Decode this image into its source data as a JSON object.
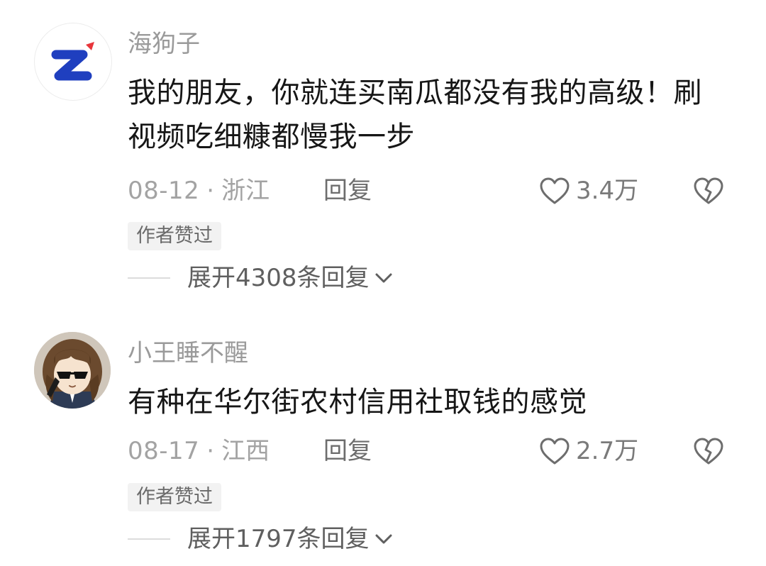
{
  "comments": [
    {
      "username": "海狗子",
      "content": "我的朋友，你就连买南瓜都没有我的高级！刷视频吃细糠都慢我一步",
      "date": "08-12",
      "separator": "·",
      "location": "浙江",
      "reply_label": "回复",
      "likes": "3.4万",
      "badge": "作者赞过",
      "expand_label": "展开4308条回复",
      "avatar_icon": "z-logo-icon"
    },
    {
      "username": "小王睡不醒",
      "content": "有种在华尔街农村信用社取钱的感觉",
      "date": "08-17",
      "separator": "·",
      "location": "江西",
      "reply_label": "回复",
      "likes": "2.7万",
      "badge": "作者赞过",
      "expand_label": "展开1797条回复",
      "avatar_icon": "anime-girl-sunglasses-icon"
    }
  ],
  "colors": {
    "username": "#9a9a9a",
    "content": "#161616",
    "meta": "#a3a3a3",
    "badge_bg": "#f2f2f2",
    "accent_blue": "#1f3fbf",
    "accent_red": "#e8353b"
  }
}
